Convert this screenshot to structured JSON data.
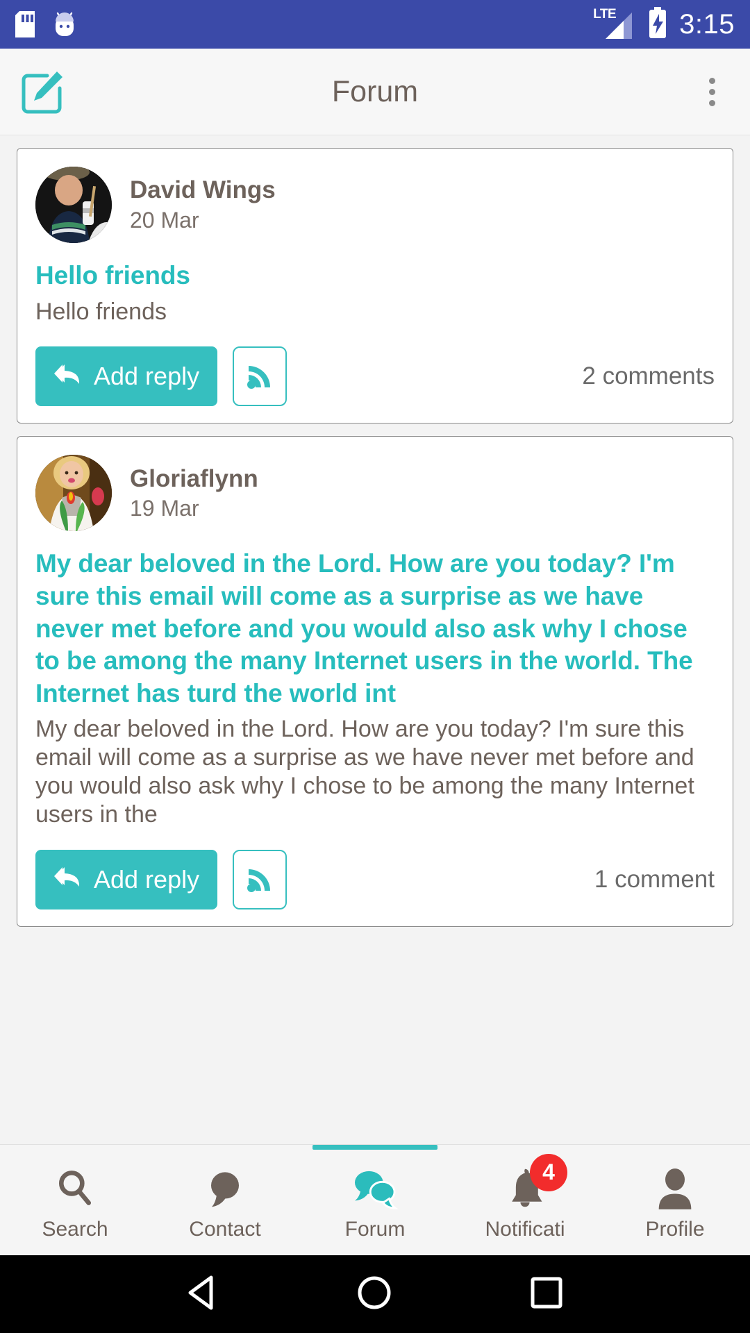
{
  "status_bar": {
    "icons_left": [
      "sd-card-icon",
      "android-head-icon"
    ],
    "network_label": "LTE",
    "signal_icon": "signal-bars-icon",
    "battery_icon": "battery-charging-icon",
    "time": "3:15",
    "background_color": "#3b4aa8"
  },
  "app_bar": {
    "compose_icon": "compose-edit-icon",
    "title": "Forum",
    "overflow_icon": "more-vertical-icon",
    "accent_color": "#36bfbf",
    "title_color": "#6d625b"
  },
  "feed": {
    "posts": [
      {
        "author": "David Wings",
        "date": "20 Mar",
        "title": "Hello friends",
        "body": "Hello friends",
        "reply_label": "Add reply",
        "reply_icon": "reply-all-icon",
        "subscribe_icon": "rss-feed-icon",
        "comments": "2 comments",
        "avatar": "user-photo-david"
      },
      {
        "author": "Gloriaflynn",
        "date": "19 Mar",
        "title": "My dear beloved in the Lord. How are you today? I'm sure this email will come as a surprise as we have never met before and you would also ask why I chose to be among the many Internet users in the world. The Internet has turd the world int",
        "body": "My dear beloved in the Lord. How are you today? I'm sure this email will come as a surprise as we have never met before and you would also ask why I chose to be among the many Internet users in the",
        "reply_label": "Add reply",
        "reply_icon": "reply-all-icon",
        "subscribe_icon": "rss-feed-icon",
        "comments": "1 comment",
        "avatar": "user-photo-gloria"
      }
    ]
  },
  "bottom_nav": {
    "active_index": 2,
    "active_color": "#36bfbf",
    "inactive_color": "#6d625b",
    "items": [
      {
        "label": "Search",
        "icon": "search-icon",
        "badge": ""
      },
      {
        "label": "Contact",
        "icon": "chat-bubble-icon",
        "badge": ""
      },
      {
        "label": "Forum",
        "icon": "forum-bubbles-icon",
        "badge": ""
      },
      {
        "label": "Notificati",
        "icon": "bell-icon",
        "badge": "4"
      },
      {
        "label": "Profile",
        "icon": "person-icon",
        "badge": ""
      }
    ]
  },
  "system_nav": {
    "back_icon": "back-triangle-icon",
    "home_icon": "home-circle-icon",
    "recents_icon": "recents-square-icon"
  }
}
